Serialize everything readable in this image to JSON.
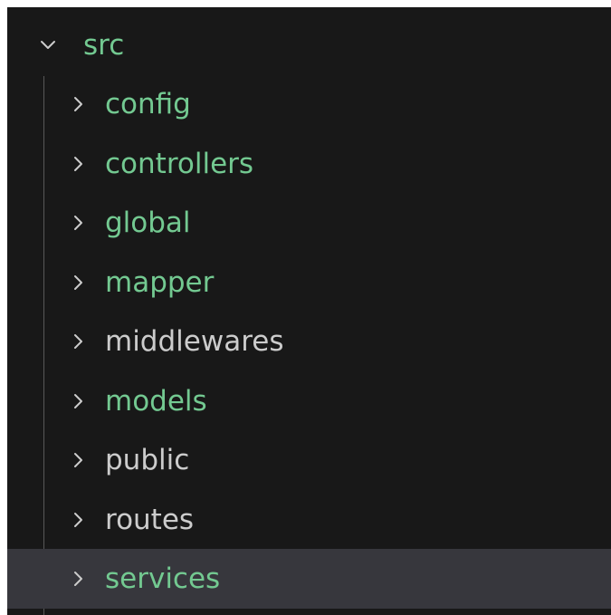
{
  "colors": {
    "background": "#181818",
    "selected_row": "#37373d",
    "chevron": "#cccccc",
    "guide_line": "#585858",
    "modified_folder": "#73c991",
    "plain_folder": "#cccccc"
  },
  "tree": {
    "root": {
      "label": "src",
      "icon": "chevron-down-icon",
      "expanded": true
    },
    "folders": [
      {
        "label": "config",
        "icon": "chevron-right-icon",
        "modified": true,
        "selected": false
      },
      {
        "label": "controllers",
        "icon": "chevron-right-icon",
        "modified": true,
        "selected": false
      },
      {
        "label": "global",
        "icon": "chevron-right-icon",
        "modified": true,
        "selected": false
      },
      {
        "label": "mapper",
        "icon": "chevron-right-icon",
        "modified": true,
        "selected": false
      },
      {
        "label": "middlewares",
        "icon": "chevron-right-icon",
        "modified": false,
        "selected": false
      },
      {
        "label": "models",
        "icon": "chevron-right-icon",
        "modified": true,
        "selected": false
      },
      {
        "label": "public",
        "icon": "chevron-right-icon",
        "modified": false,
        "selected": false
      },
      {
        "label": "routes",
        "icon": "chevron-right-icon",
        "modified": false,
        "selected": false
      },
      {
        "label": "services",
        "icon": "chevron-right-icon",
        "modified": true,
        "selected": true
      }
    ]
  }
}
